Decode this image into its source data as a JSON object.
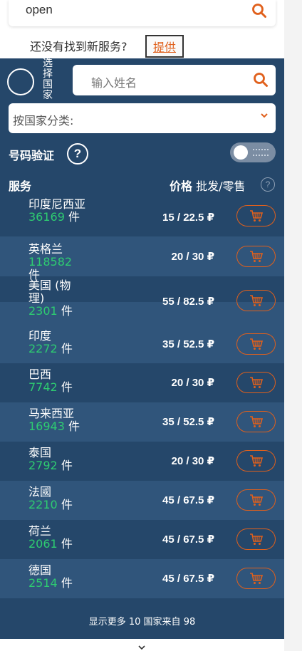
{
  "top_search": {
    "value": "open",
    "icon": "search-icon"
  },
  "not_found": {
    "text": "还没有找到新服务?",
    "provide_label": "提供"
  },
  "filters": {
    "select_country_label": "选择国家",
    "name_placeholder": "输入姓名",
    "country_category_label": "按国家分类:"
  },
  "verification": {
    "label": "号码验证",
    "help": "?"
  },
  "table_header": {
    "service": "服务",
    "price": "价格",
    "wholesale_retail": "批发/零售",
    "help": "?"
  },
  "rows": [
    {
      "country": "印度尼西亚",
      "count": "36169",
      "unit": "件",
      "wholesale": "15",
      "retail": "22.5",
      "currency": "₽"
    },
    {
      "country": "英格兰",
      "count": "118582",
      "unit": "件",
      "wholesale": "20",
      "retail": "30",
      "currency": "₽"
    },
    {
      "country": "美国 (物理)",
      "count": "2301",
      "unit": "件",
      "wholesale": "55",
      "retail": "82.5",
      "currency": "₽"
    },
    {
      "country": "印度",
      "count": "2272",
      "unit": "件",
      "wholesale": "35",
      "retail": "52.5",
      "currency": "₽"
    },
    {
      "country": "巴西",
      "count": "7742",
      "unit": "件",
      "wholesale": "20",
      "retail": "30",
      "currency": "₽"
    },
    {
      "country": "马来西亚",
      "count": "16943",
      "unit": "件",
      "wholesale": "35",
      "retail": "52.5",
      "currency": "₽"
    },
    {
      "country": "泰国",
      "count": "2792",
      "unit": "件",
      "wholesale": "20",
      "retail": "30",
      "currency": "₽"
    },
    {
      "country": "法國",
      "count": "2210",
      "unit": "件",
      "wholesale": "45",
      "retail": "67.5",
      "currency": "₽"
    },
    {
      "country": "荷兰",
      "count": "2061",
      "unit": "件",
      "wholesale": "45",
      "retail": "67.5",
      "currency": "₽"
    },
    {
      "country": "德国",
      "count": "2514",
      "unit": "件",
      "wholesale": "45",
      "retail": "67.5",
      "currency": "₽"
    }
  ],
  "footer": {
    "show_more": "显示更多 10 国家来自 98"
  },
  "colors": {
    "panel": "#25476a",
    "row_alt": "#30557b",
    "accent": "#e0601c",
    "count_green": "#2ecc71"
  }
}
